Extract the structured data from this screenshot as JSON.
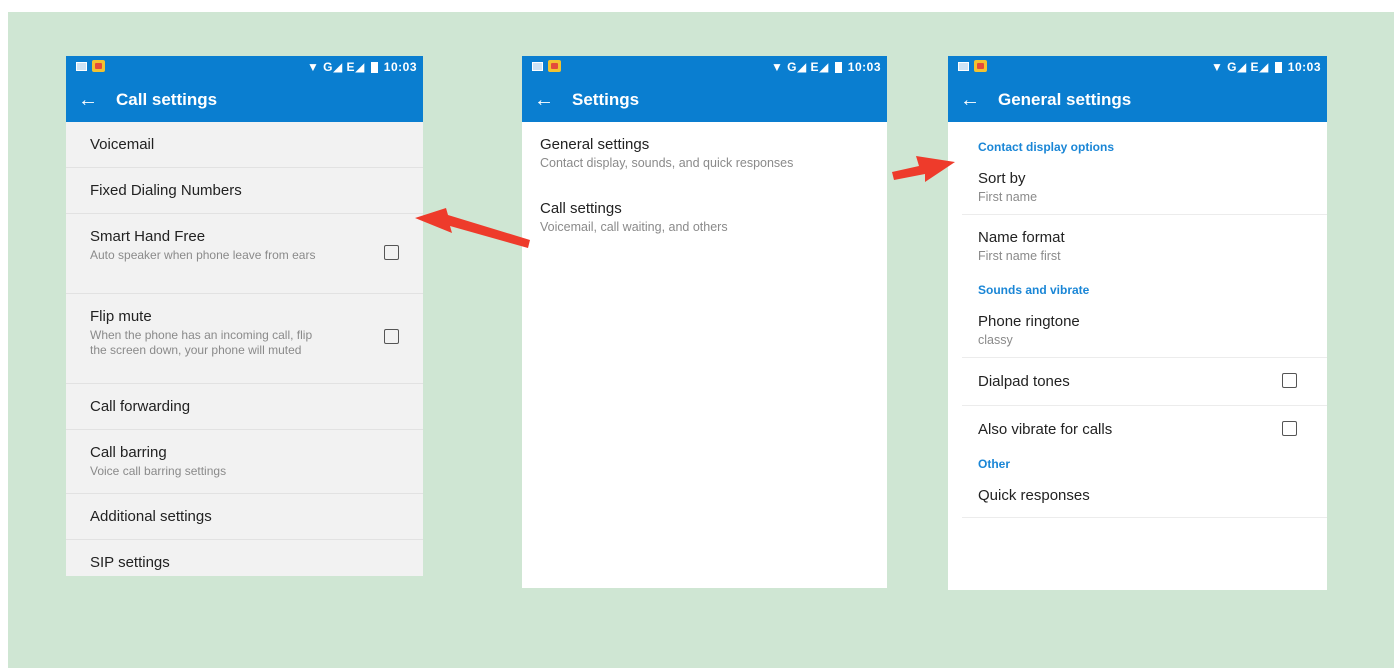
{
  "colors": {
    "background": "#cfe6d3",
    "primary": "#0a7ed0",
    "accent_text": "#1a86d6",
    "arrow": "#ee3b2b"
  },
  "statusbar": {
    "signal": "▼ G◢ E◢",
    "time": "10:03"
  },
  "phone1": {
    "title": "Call settings",
    "items": [
      {
        "title": "Voicemail"
      },
      {
        "title": "Fixed Dialing Numbers"
      },
      {
        "title": "Smart Hand Free",
        "subtitle": "Auto speaker when phone leave from ears",
        "checked": false
      },
      {
        "title": "Flip mute",
        "subtitle": "When the phone has an incoming call, flip the screen down, your phone will muted",
        "checked": false
      },
      {
        "title": "Call forwarding"
      },
      {
        "title": "Call barring",
        "subtitle": "Voice call barring settings"
      },
      {
        "title": "Additional settings"
      },
      {
        "title": "SIP settings"
      }
    ]
  },
  "phone2": {
    "title": "Settings",
    "items": [
      {
        "title": "General settings",
        "subtitle": "Contact display, sounds, and quick responses"
      },
      {
        "title": "Call settings",
        "subtitle": "Voicemail, call waiting, and others"
      }
    ]
  },
  "phone3": {
    "title": "General settings",
    "sections": {
      "contact_display": "Contact display options",
      "sounds": "Sounds and vibrate",
      "other": "Other"
    },
    "sort_by": {
      "title": "Sort by",
      "subtitle": "First name"
    },
    "name_format": {
      "title": "Name format",
      "subtitle": "First name first"
    },
    "ringtone": {
      "title": "Phone ringtone",
      "subtitle": "classy"
    },
    "dialpad_tones": {
      "title": "Dialpad tones",
      "checked": false
    },
    "vibrate_calls": {
      "title": "Also vibrate for calls",
      "checked": false
    },
    "quick_responses": {
      "title": "Quick responses"
    }
  },
  "icons": [
    "back-arrow-icon",
    "screenshot-icon",
    "photo-icon",
    "wifi-icon",
    "signal-icon",
    "battery-icon",
    "checkbox-icon",
    "red-arrow-icon"
  ]
}
